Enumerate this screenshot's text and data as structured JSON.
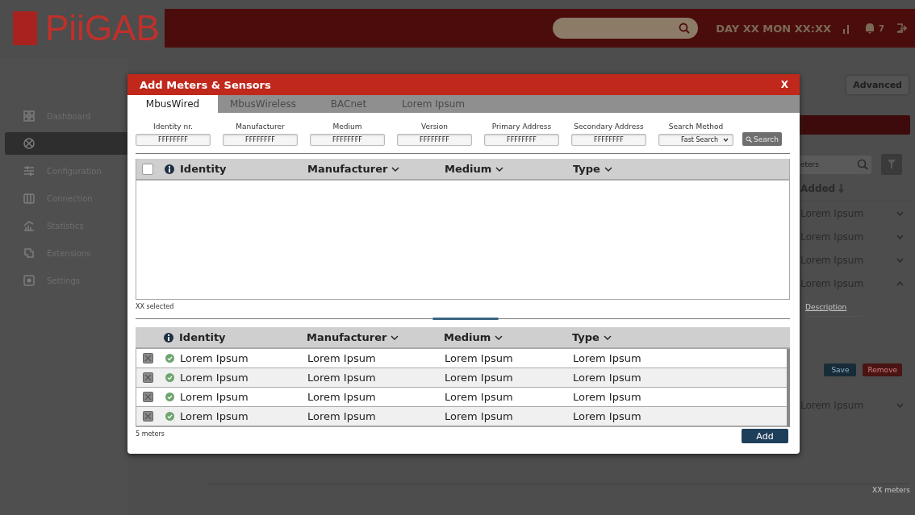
{
  "header": {
    "logo": "PiiGAB",
    "datetime": "DAY XX MON XX:XX",
    "notification_count": "7"
  },
  "sidebar": {
    "items": [
      {
        "label": "Dashboard",
        "selected": false
      },
      {
        "selected": true
      },
      {
        "label": "Configuration",
        "selected": false
      },
      {
        "label": "Connection",
        "selected": false
      },
      {
        "label": "Statistics",
        "selected": false
      },
      {
        "label": "Extensions",
        "selected": false
      },
      {
        "label": "Settings",
        "selected": false
      }
    ]
  },
  "advanced_button": "Advanced",
  "meter_list": {
    "search": {
      "placeholder": "eters"
    },
    "sort_column": "Added",
    "rows": [
      {
        "label": "Lorem Ipsum",
        "expanded": false
      },
      {
        "label": "Lorem Ipsum",
        "expanded": false
      },
      {
        "label": "Lorem Ipsum",
        "expanded": false
      },
      {
        "label": "Lorem Ipsum",
        "expanded": true
      },
      {
        "label": "Lorem Ipsum",
        "expanded": false
      }
    ],
    "description_link": "Description",
    "save_button": "Save",
    "remove_button": "Remove",
    "footer": "XX meters"
  },
  "modal": {
    "title": "Add Meters & Sensors",
    "close": "X",
    "tabs": [
      {
        "label": "MbusWired",
        "selected": true
      },
      {
        "label": "MbusWireless",
        "selected": false
      },
      {
        "label": "BACnet",
        "selected": false
      },
      {
        "label": "Lorem Ipsum",
        "selected": false
      }
    ],
    "filters": [
      {
        "label": "Identity nr.",
        "value": "FFFFFFFF",
        "kind": "text"
      },
      {
        "label": "Manufacturer",
        "value": "FFFFFFFF",
        "kind": "text"
      },
      {
        "label": "Medium",
        "value": "FFFFFFFF",
        "kind": "text"
      },
      {
        "label": "Version",
        "value": "FFFFFFFF",
        "kind": "text"
      },
      {
        "label": "Primary Address",
        "value": "FFFFFFFF",
        "kind": "text"
      },
      {
        "label": "Secondary Address",
        "value": "FFFFFFFF",
        "kind": "text"
      },
      {
        "label": "Search Method",
        "value": "Fast Search",
        "kind": "select"
      }
    ],
    "search_button": "Search",
    "results": {
      "all_checked": false,
      "columns": [
        {
          "label": "Identity",
          "sortable": false
        },
        {
          "label": "Manufacturer",
          "sortable": true
        },
        {
          "label": "Medium",
          "sortable": true
        },
        {
          "label": "Type",
          "sortable": true
        }
      ],
      "footer": "XX selected"
    },
    "selected_meters": {
      "columns": [
        {
          "label": "Identity",
          "sortable": false
        },
        {
          "label": "Manufacturer",
          "sortable": true
        },
        {
          "label": "Medium",
          "sortable": true
        },
        {
          "label": "Type",
          "sortable": true
        }
      ],
      "rows": [
        {
          "checked": true,
          "cells": [
            "Lorem Ipsum",
            "Lorem Ipsum",
            "Lorem Ipsum",
            "Lorem Ipsum"
          ]
        },
        {
          "checked": true,
          "cells": [
            "Lorem Ipsum",
            "Lorem Ipsum",
            "Lorem Ipsum",
            "Lorem Ipsum"
          ]
        },
        {
          "checked": true,
          "cells": [
            "Lorem Ipsum",
            "Lorem Ipsum",
            "Lorem Ipsum",
            "Lorem Ipsum"
          ]
        },
        {
          "checked": true,
          "cells": [
            "Lorem Ipsum",
            "Lorem Ipsum",
            "Lorem Ipsum",
            "Lorem Ipsum"
          ]
        }
      ],
      "footer": "5 meters"
    },
    "add_button": "Add"
  }
}
